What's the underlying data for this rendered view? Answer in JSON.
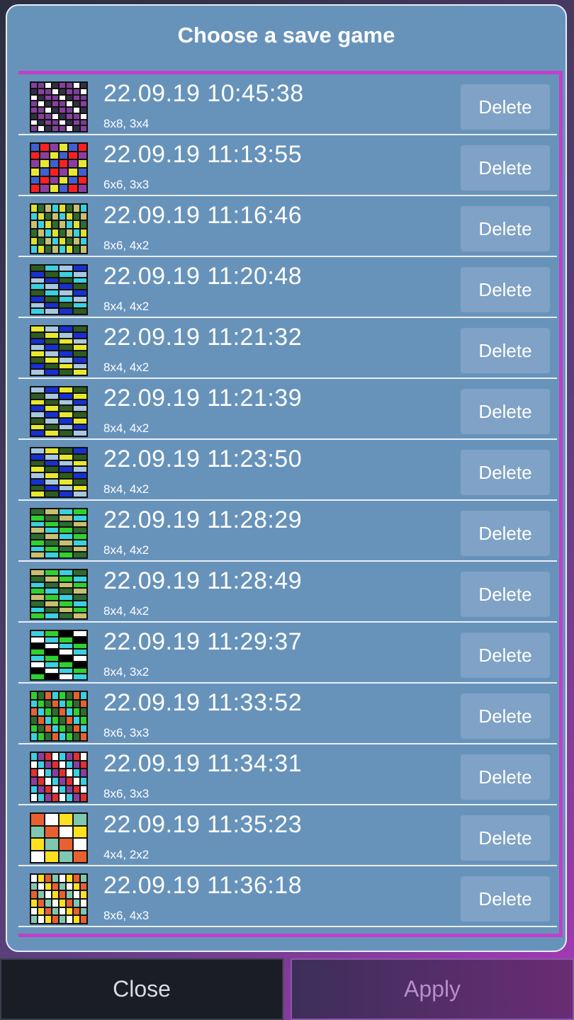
{
  "dialog": {
    "title": "Choose a save game",
    "delete_label": "Delete"
  },
  "footer": {
    "close_label": "Close",
    "apply_label": "Apply"
  },
  "saves": [
    {
      "date": "22.09.19 10:45:38",
      "meta": "8x8, 3x4",
      "palette": [
        "#8a3fa0",
        "#2f2f45",
        "#ffffff",
        "#7a3f95"
      ],
      "cols": 8,
      "rows": 8
    },
    {
      "date": "22.09.19 11:13:55",
      "meta": "6x6, 3x3",
      "palette": [
        "#e8e830",
        "#8a3fa0",
        "#ff2020",
        "#4060d0"
      ],
      "cols": 6,
      "rows": 6
    },
    {
      "date": "22.09.19 11:16:46",
      "meta": "8x6, 4x2",
      "palette": [
        "#c8c070",
        "#2f6a2f",
        "#e0e030",
        "#3ad0e0"
      ],
      "cols": 8,
      "rows": 6
    },
    {
      "date": "22.09.19 11:20:48",
      "meta": "8x4, 4x2",
      "palette": [
        "#3ad0e0",
        "#2f5a20",
        "#1830d0",
        "#a8c8e0"
      ],
      "cols": 4,
      "rows": 8
    },
    {
      "date": "22.09.19 11:21:32",
      "meta": "8x4, 4x2",
      "palette": [
        "#e8e830",
        "#2f5a20",
        "#1830d0",
        "#a8c8e0"
      ],
      "cols": 4,
      "rows": 8
    },
    {
      "date": "22.09.19 11:21:39",
      "meta": "8x4, 4x2",
      "palette": [
        "#2f5a20",
        "#e8e830",
        "#1830d0",
        "#a8c8e0"
      ],
      "cols": 4,
      "rows": 8
    },
    {
      "date": "22.09.19 11:23:50",
      "meta": "8x4, 4x2",
      "palette": [
        "#2f5a20",
        "#e8e830",
        "#a8c8e0",
        "#1830d0"
      ],
      "cols": 4,
      "rows": 8
    },
    {
      "date": "22.09.19 11:28:29",
      "meta": "8x4, 4x2",
      "palette": [
        "#c8c070",
        "#2f6a2f",
        "#30d030",
        "#3ad0e0"
      ],
      "cols": 4,
      "rows": 8
    },
    {
      "date": "22.09.19 11:28:49",
      "meta": "8x4, 4x2",
      "palette": [
        "#c8c070",
        "#2f6a2f",
        "#3ad0e0",
        "#30d030"
      ],
      "cols": 4,
      "rows": 8
    },
    {
      "date": "22.09.19 11:29:37",
      "meta": "8x4, 3x2",
      "palette": [
        "#ffffff",
        "#000000",
        "#30d030",
        "#3ad0e0"
      ],
      "cols": 4,
      "rows": 8
    },
    {
      "date": "22.09.19 11:33:52",
      "meta": "8x6, 3x3",
      "palette": [
        "#e86030",
        "#2f6a2f",
        "#30d030",
        "#3ad0e0"
      ],
      "cols": 8,
      "rows": 6
    },
    {
      "date": "22.09.19 11:34:31",
      "meta": "8x6, 3x3",
      "palette": [
        "#8a3fa0",
        "#3ad0e0",
        "#ffffff",
        "#e03030"
      ],
      "cols": 8,
      "rows": 6
    },
    {
      "date": "22.09.19 11:35:23",
      "meta": "4x4, 2x2",
      "palette": [
        "#e86030",
        "#7fc8b0",
        "#ffe020",
        "#ffffff"
      ],
      "cols": 4,
      "rows": 4
    },
    {
      "date": "22.09.19 11:36:18",
      "meta": "8x6, 4x3",
      "palette": [
        "#7fc8b0",
        "#e86030",
        "#ffe020",
        "#ffffff"
      ],
      "cols": 8,
      "rows": 6
    }
  ]
}
